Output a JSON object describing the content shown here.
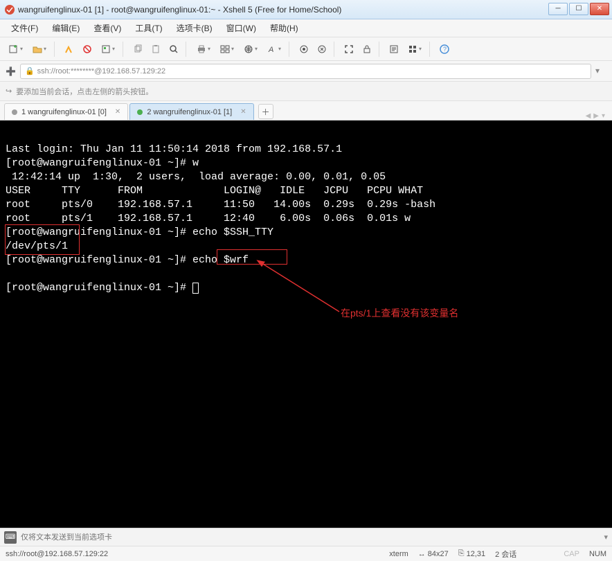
{
  "titlebar": {
    "title": "wangruifenglinux-01 [1] - root@wangruifenglinux-01:~ - Xshell 5 (Free for Home/School)"
  },
  "menu": {
    "file": "文件(F)",
    "edit": "编辑(E)",
    "view": "查看(V)",
    "tools": "工具(T)",
    "tab": "选项卡(B)",
    "window": "窗口(W)",
    "help": "帮助(H)"
  },
  "addressbar": {
    "lock": "🔒",
    "url": "ssh://root:********@192.168.57.129:22"
  },
  "hint": {
    "text": "要添加当前会话，点击左侧的箭头按钮。"
  },
  "tabs": [
    {
      "label": "1 wangruifenglinux-01 [0]",
      "active": false,
      "dot": "gray"
    },
    {
      "label": "2 wangruifenglinux-01 [1]",
      "active": true,
      "dot": "green"
    }
  ],
  "terminal": {
    "lines": [
      "",
      "Last login: Thu Jan 11 11:50:14 2018 from 192.168.57.1",
      "[root@wangruifenglinux-01 ~]# w",
      " 12:42:14 up  1:30,  2 users,  load average: 0.00, 0.01, 0.05",
      "USER     TTY      FROM             LOGIN@   IDLE   JCPU   PCPU WHAT",
      "root     pts/0    192.168.57.1     11:50   14.00s  0.29s  0.29s -bash",
      "root     pts/1    192.168.57.1     12:40    6.00s  0.06s  0.01s w",
      "[root@wangruifenglinux-01 ~]# echo $SSH_TTY",
      "/dev/pts/1",
      "[root@wangruifenglinux-01 ~]# echo $wrf",
      "",
      "[root@wangruifenglinux-01 ~]# "
    ],
    "annotation": "在pts/1上查看没有该变量名"
  },
  "bottominput": {
    "placeholder": "仅将文本发送到当前选项卡"
  },
  "statusbar": {
    "conn": "ssh://root@192.168.57.129:22",
    "term": "xterm",
    "size": "84x27",
    "pos": "12,31",
    "sessions": "2 会话",
    "cap": "CAP",
    "num": "NUM"
  }
}
